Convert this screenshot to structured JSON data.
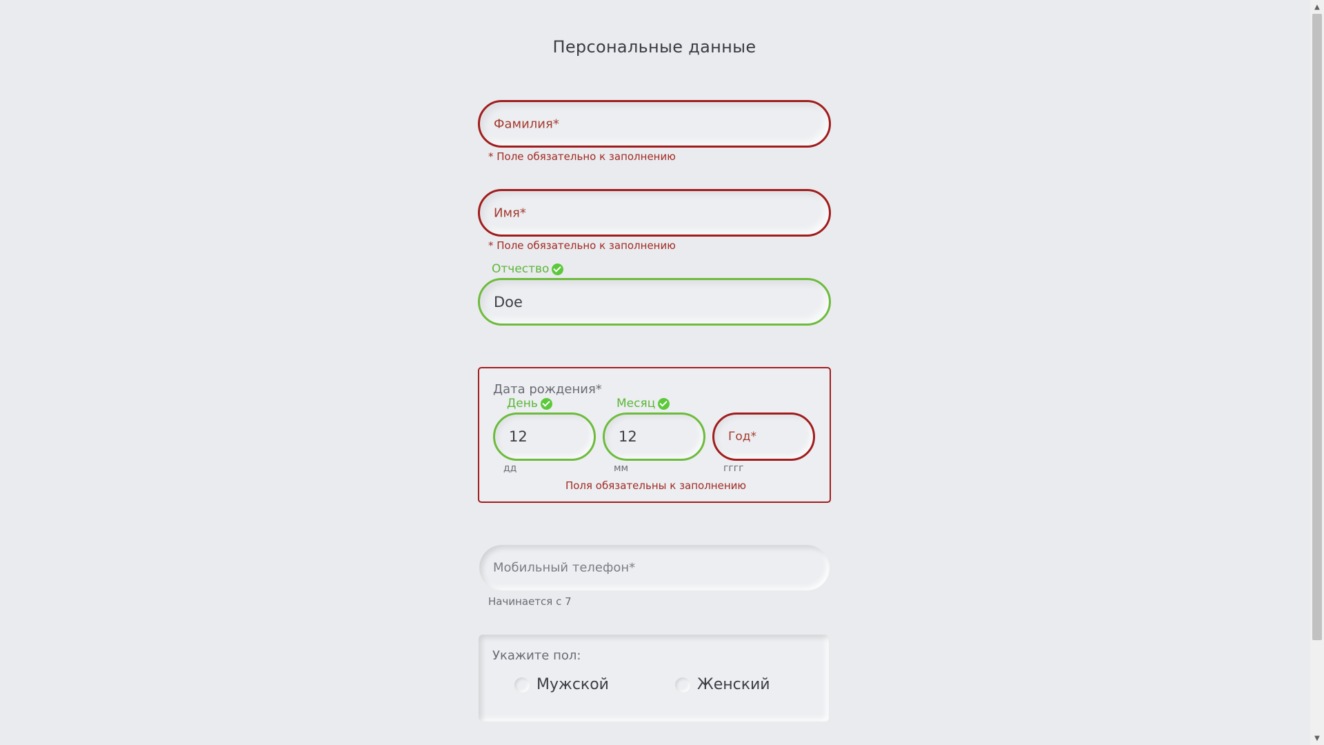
{
  "title": "Персональные данные",
  "surname": {
    "placeholder": "Фамилия*",
    "error": "* Поле обязательно к заполнению"
  },
  "name": {
    "placeholder": "Имя*",
    "error": "* Поле обязательно к заполнению"
  },
  "patronymic": {
    "label": "Отчество",
    "value": "Doe"
  },
  "dob": {
    "title": "Дата рождения*",
    "day": {
      "label": "День",
      "value": "12",
      "format": "дд"
    },
    "month": {
      "label": "Месяц",
      "value": "12",
      "format": "мм"
    },
    "year": {
      "placeholder": "Год*",
      "format": "гггг"
    },
    "error": "Поля обязательны к заполнению"
  },
  "phone": {
    "placeholder": "Мобильный телефон*",
    "hint": "Начинается с 7"
  },
  "gender": {
    "title": "Укажите пол:",
    "options": [
      "Мужской",
      "Женский"
    ]
  },
  "colors": {
    "error": "#a11c1c",
    "ok": "#6dbb3c",
    "background": "#eaebee"
  }
}
